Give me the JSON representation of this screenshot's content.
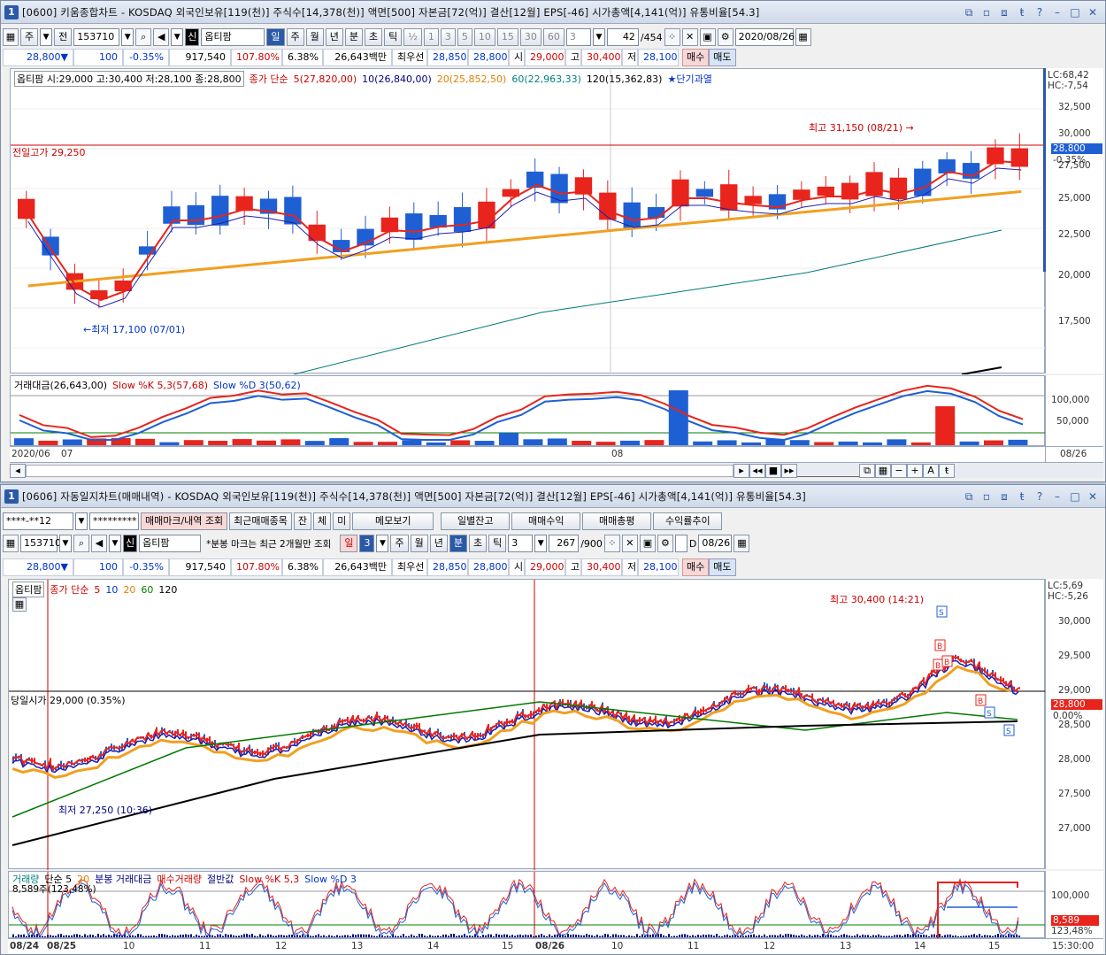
{
  "colors": {
    "up": "#e8241c",
    "down": "#1f5fd4",
    "ma5": "#e8241c",
    "ma10": "#1f1fb0",
    "ma20": "#f0a020",
    "ma60": "#007878",
    "ma120": "#000000"
  },
  "w1": {
    "num": "1",
    "title": "[0600] 키움종합차트 - KOSDAQ 외국인보유[119(천)] 주식수[14,378(천)] 액면[500] 자본금[72(억)] 결산[12월] EPS[-46] 시가총액[4,141(억)] 유통비율[54.3]",
    "toolbar": {
      "period": "주",
      "prev": "전",
      "code": "153710",
      "name": "옵티팜",
      "name_badge": "신",
      "tabs": [
        "일",
        "주",
        "월",
        "년",
        "분",
        "초",
        "틱"
      ],
      "active_tab": "일",
      "intervals": [
        "½",
        "1",
        "3",
        "5",
        "10",
        "15",
        "30",
        "60"
      ],
      "count": "3",
      "pages": "42",
      "total": "/454",
      "date": "2020/08/26"
    },
    "quote": {
      "price": "28,800▼",
      "change": "100",
      "pct": "-0.35%",
      "volume": "917,540",
      "vol_ratio": "107.80%",
      "turnover": "6.38%",
      "amount": "26,643백만",
      "best_label": "최우선",
      "ask": "28,850",
      "bid": "28,800",
      "open_l": "시",
      "open": "29,000",
      "high_l": "고",
      "high": "30,400",
      "low_l": "저",
      "low": "28,100",
      "buy": "매수",
      "sell": "매도"
    },
    "legend": {
      "name": "옵티팜 시:29,000 고:30,400 저:28,100 종:28,800",
      "ma_type": "종가 단순",
      "ma5": "5(27,820,00)",
      "ma10": "10(26,840,00)",
      "ma20": "20(25,852,50)",
      "ma60": "60(22,963,33)",
      "ma120": "120(15,362,83)",
      "signal": "★단기과열"
    },
    "annotations": {
      "high": "최고 31,150 (08/21) →",
      "low": "←최저 17,100 (07/01)",
      "prev_high": "전일고가 29,250"
    },
    "right_top": {
      "lc": "LC:68,42",
      "hc": "HC:-7,54"
    },
    "price_tag": "28,800",
    "price_pct": "-0.35%",
    "y_ticks": [
      "32,500",
      "30,000",
      "27,500",
      "25,000",
      "22,500",
      "20,000",
      "17,500"
    ],
    "sub_legend": {
      "amount": "거래대금(26,643,00)",
      "k": "Slow %K 5,3(57,68)",
      "d": "Slow %D 3(50,62)"
    },
    "sub_ticks": [
      "100,000",
      "50,000"
    ],
    "x_labels": {
      "start": "2020/06",
      "m07": "07",
      "m08": "08",
      "end": "08/26"
    }
  },
  "w2": {
    "num": "1",
    "title": "[0606] 자동일지차트(매매내역) - KOSDAQ 외국인보유[119(천)] 주식수[14,378(천)] 액면[500] 자본금[72(억)] 결산[12월] EPS[-46] 시가총액[4,141(억)] 유통비율[54.3]",
    "toolbar1": {
      "account": "****-**12",
      "password": "*********",
      "b_mark": "매매마크/내역 조회",
      "b_items": "최근매매종목",
      "b_jan": "잔",
      "b_che": "체",
      "b_mi": "미",
      "b_memo": "메모보기",
      "b_daily": "일별잔고",
      "b_profit": "매매수익",
      "b_total": "매매총평",
      "b_trend": "수익률추이"
    },
    "toolbar2": {
      "code": "153710",
      "name": "옵티팜",
      "name_badge": "신",
      "note": "*분봉 마크는 최근 2개월만 조회",
      "day": "일",
      "num": "3",
      "tabs": [
        "주",
        "월",
        "년",
        "분",
        "초",
        "틱"
      ],
      "active_tab": "분",
      "interval": "3",
      "pages": "267",
      "total": "/900",
      "check_label": "D",
      "date": "08/26"
    },
    "quote": {
      "price": "28,800▼",
      "change": "100",
      "pct": "-0.35%",
      "volume": "917,540",
      "vol_ratio": "107.80%",
      "turnover": "6.38%",
      "amount": "26,643백만",
      "best_label": "최우선",
      "ask": "28,850",
      "bid": "28,800",
      "open_l": "시",
      "open": "29,000",
      "high_l": "고",
      "high": "30,400",
      "low_l": "저",
      "low": "28,100",
      "buy": "매수",
      "sell": "매도"
    },
    "legend": {
      "name": "옵티팜",
      "ma_type": "종가 단순",
      "ma5": "5",
      "ma10": "10",
      "ma20": "20",
      "ma60": "60",
      "ma120": "120"
    },
    "annotations": {
      "high": "최고 30,400 (14:21)",
      "low": "최저 27,250 (10:36)",
      "open": "당일시가 29,000 (0.35%)"
    },
    "right_top": {
      "lc": "LC:5,69",
      "hc": "HC:-5,26"
    },
    "price_tag": "28,800",
    "price_pct": "0.00%",
    "y_ticks": [
      "30,000",
      "29,500",
      "29,000",
      "28,500",
      "28,000",
      "27,500",
      "27,000"
    ],
    "sub_legend": {
      "vol": "거래량",
      "ma": "단순 5",
      "ma20": "20",
      "amount": "분봉 거래대금",
      "buyvol": "매수거래량",
      "half": "절반값",
      "k": "Slow %K 5,3",
      "d": "Slow %D 3"
    },
    "sub_info": "8,589주(123,48%)",
    "sub_ticks": [
      "100,000"
    ],
    "sub_tag1": "8,589",
    "sub_tag2": "123,48%",
    "x_labels": [
      "08/24",
      "08/25",
      "10",
      "11",
      "12",
      "13",
      "14",
      "15",
      "08/26",
      "10",
      "11",
      "12",
      "13",
      "14",
      "15",
      "15:30:00"
    ]
  }
}
